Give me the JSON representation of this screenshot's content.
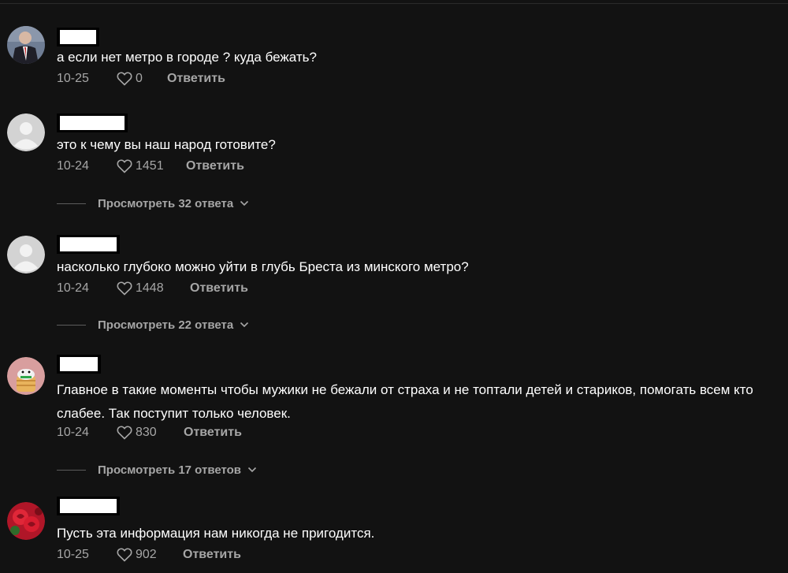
{
  "comments": [
    {
      "text": "а если нет метро в городе ? куда бежать?",
      "date": "10-25",
      "likes": "0",
      "reply": "Ответить",
      "replies": null
    },
    {
      "text": "это к чему вы наш народ готовите?",
      "date": "10-24",
      "likes": "1451",
      "reply": "Ответить",
      "replies": "Просмотреть 32 ответа"
    },
    {
      "text": "насколько глубоко можно уйти в глубь Бреста из минского метро?",
      "date": "10-24",
      "likes": "1448",
      "reply": "Ответить",
      "replies": "Просмотреть 22 ответа"
    },
    {
      "text": "Главное в такие моменты чтобы мужики не бежали от страха и не топтали детей и стариков, помогать всем кто слабее. Так поступит только человек.",
      "date": "10-24",
      "likes": "830",
      "reply": "Ответить",
      "replies": "Просмотреть 17 ответов"
    },
    {
      "text": "Пусть эта информация нам никогда не пригодится.",
      "date": "10-25",
      "likes": "902",
      "reply": "Ответить",
      "replies": null
    }
  ],
  "icons": {
    "like": "heart-outline-icon",
    "expand": "chevron-down-icon",
    "avatar_default": "default-user-avatar-icon"
  },
  "colors": {
    "background": "#121212",
    "text_primary": "#ffffff",
    "text_secondary": "#a6a6a6"
  }
}
